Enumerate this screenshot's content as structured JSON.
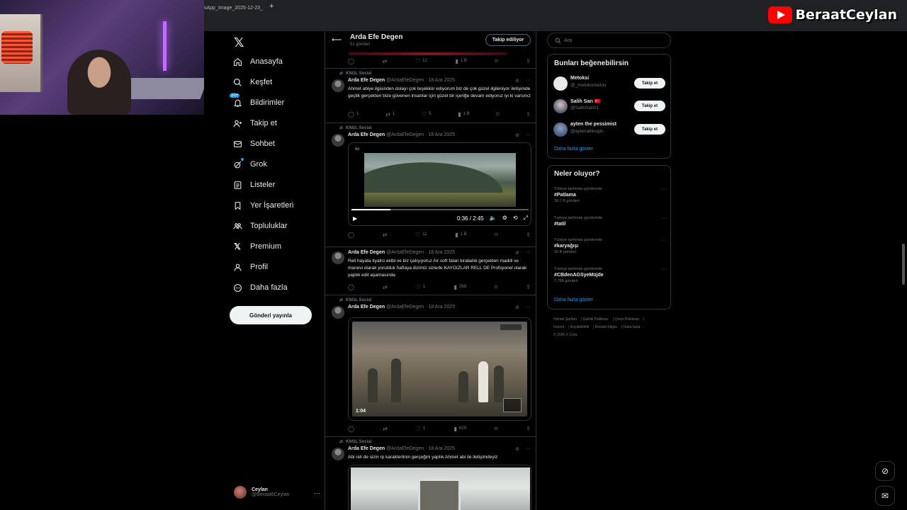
{
  "browser": {
    "tab_title": "sApp_Image_2025-12-23_",
    "tab_close": "×",
    "new_tab": "+"
  },
  "streamer": {
    "channel_name": "BeraatCeylan"
  },
  "nav": {
    "items": [
      {
        "label": "Anasayfa",
        "icon": "home-icon"
      },
      {
        "label": "Keşfet",
        "icon": "search-icon"
      },
      {
        "label": "Bildirimler",
        "icon": "bell-icon",
        "badge": "20+"
      },
      {
        "label": "Takip et",
        "icon": "follow-icon"
      },
      {
        "label": "Sohbet",
        "icon": "mail-icon"
      },
      {
        "label": "Grok",
        "icon": "grok-icon"
      },
      {
        "label": "Listeler",
        "icon": "list-icon"
      },
      {
        "label": "Yer İşaretleri",
        "icon": "bookmark-icon"
      },
      {
        "label": "Topluluklar",
        "icon": "communities-icon"
      },
      {
        "label": "Premium",
        "icon": "x-icon"
      },
      {
        "label": "Profil",
        "icon": "profile-icon"
      },
      {
        "label": "Daha fazla",
        "icon": "more-icon"
      }
    ],
    "post_button": "Gönderi yayınla",
    "account": {
      "name": "Ceylan",
      "handle": "@Beraat6Ceylan"
    }
  },
  "profile_header": {
    "name": "Arda Efe Degen",
    "post_count": "51 gönderi",
    "follow_label": "Takip ediliyor"
  },
  "top_actions": {
    "likes": "12",
    "views": "1 B"
  },
  "tweets": [
    {
      "repost_label": "KNGL Social",
      "author": "Arda Efe Degen",
      "meta": "@ArdaEfeDegen · 18 Ara 2025",
      "text": "Ahmet abiye ilgisinden dolayı çok teşekkür ediyorum biz de çok güzel ilgileniyor iletişimde geçtik gerçekten bize güvenen insanlar için güzel bir içeriğe devam ediyoruz iyi ki varsınız",
      "replies": "1",
      "reposts": "1",
      "likes": "5",
      "views": "1 B"
    },
    {
      "repost_label": "KNGL Social",
      "author": "Arda Efe Degen",
      "meta": "@ArdaEfeDegen · 18 Ara 2025",
      "text": "",
      "video_time": "0:36 / 2:45",
      "video_tag": "Alt",
      "video_progress": 0.22,
      "replies": "",
      "reposts": "",
      "likes": "11",
      "views": "1 B"
    },
    {
      "repost_label": "",
      "author": "Arda Efe Degen",
      "meta": "@ArdaEfeDegen · 18 Ara 2025",
      "text": "Reli hayata tiyatro ekibi ve biz çalışıyoruz Air soft falan kiraladık gerçekten maddi ve manevi olarak yorulduk haftaya dizimiz sizlerle KAYGIZLAR RELL DE Profsyonel olarak yaptık edit aşamasında",
      "replies": "",
      "reposts": "",
      "likes": "1",
      "views": "269"
    },
    {
      "repost_label": "KNGL Social",
      "author": "Arda Efe Degen",
      "meta": "@ArdaEfeDegen · 18 Ara 2025",
      "text": "",
      "video_time": "1:04",
      "replies": "",
      "reposts": "",
      "likes": "1",
      "views": "629"
    },
    {
      "repost_label": "KNGL Social",
      "author": "Arda Efe Degen",
      "meta": "@ArdaEfeDegen · 18 Ara 2025",
      "text": "Abi reli de sizin rp karakterlinin gerçeğini yaptık Ahmet abi ile iletişimdeyiz"
    }
  ],
  "search": {
    "placeholder": "Ara"
  },
  "who_to_follow": {
    "title": "Bunları beğenebilirsin",
    "users": [
      {
        "name": "Metoksi",
        "handle": "@_metoksimetos",
        "button": "Takip et"
      },
      {
        "name": "Salih Sarı 🇹🇷",
        "handle": "@SalihSari01",
        "button": "Takip et"
      },
      {
        "name": "ayten the pessimist",
        "handle": "@aytenaltinoglu",
        "button": "Takip et"
      }
    ],
    "show_more": "Daha fazla göster"
  },
  "trends": {
    "title": "Neler oluyor?",
    "items": [
      {
        "context": "Türkiye tarihinde gündemde",
        "tag": "#Patlama",
        "count": "30,7 B gönderi"
      },
      {
        "context": "Türkiye tarihinde gündemde",
        "tag": "#tatil",
        "count": ""
      },
      {
        "context": "Türkiye tarihinde gündemde",
        "tag": "#karyağışı",
        "count": "16 B gönderi"
      },
      {
        "context": "Türkiye tarihinde gündemde",
        "tag": "#CBdenAGSyeMüjde",
        "count": "7.788 gönderi"
      }
    ],
    "show_more": "Daha fazla göster"
  },
  "footer": {
    "links": [
      "Hizmet Şartları",
      "Gizlilik Politikası",
      "Çerez Politikası",
      "Imprint",
      "Erişilebilirlik",
      "Reklam bilgisi",
      "Daha fazla ···"
    ],
    "copyright": "© 2026 X Corp."
  },
  "colors": {
    "accent": "#1d9bf0",
    "background": "#000000",
    "text": "#e7e9ea",
    "muted": "#71767b",
    "border": "#2f3336"
  }
}
